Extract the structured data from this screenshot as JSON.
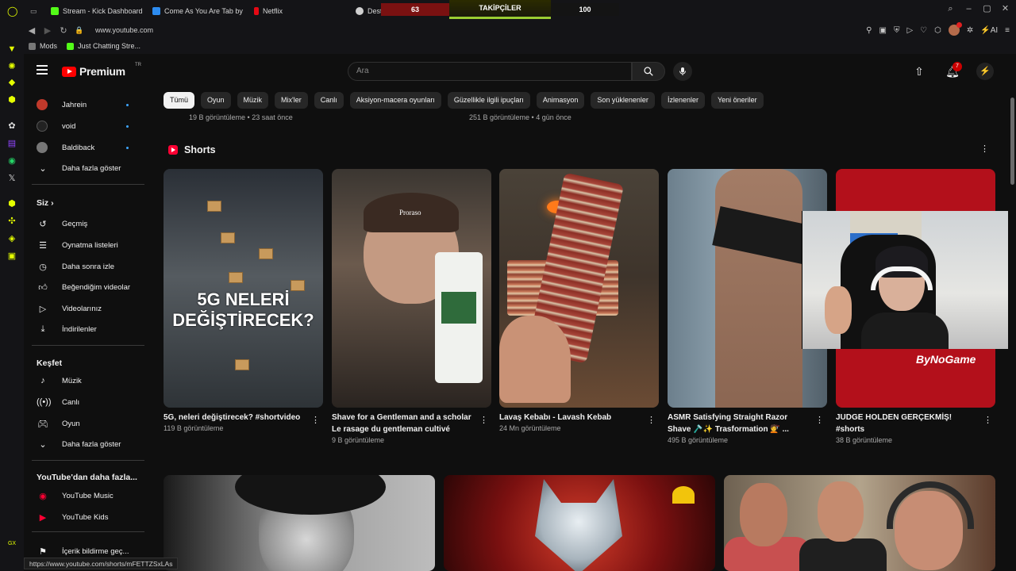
{
  "browser": {
    "tabs": [
      {
        "label": "Stream - Kick Dashboard",
        "color": "#53fc18"
      },
      {
        "label": "Come As You Are Tab by",
        "color": "#2d8cf0"
      },
      {
        "label": "Netflix",
        "color": "#e50914"
      },
      {
        "label": "Deste",
        "color": "#d0d0d0"
      }
    ],
    "url": "www.youtube.com",
    "bookmarks": [
      {
        "label": "Mods",
        "color": "#777777"
      },
      {
        "label": "Just Chatting Stre...",
        "color": "#53fc18"
      }
    ],
    "status_url": "https://www.youtube.com/shorts/mFETTZSxLAs"
  },
  "overlay": {
    "left_value": "63",
    "center_label": "TAKİPÇİLER",
    "right_value": "100"
  },
  "youtube": {
    "logo_text": "Premium",
    "logo_country": "TR",
    "search_placeholder": "Ara",
    "notification_count": "7",
    "sidebar": {
      "channels": [
        {
          "label": "Jahrein",
          "color": "#c0392b"
        },
        {
          "label": "void",
          "color": "#222222"
        },
        {
          "label": "Baldiback",
          "color": "#777777"
        }
      ],
      "show_more_1": "Daha fazla göster",
      "you_title": "Siz",
      "you_items": [
        {
          "label": "Geçmiş",
          "icon": "history-icon"
        },
        {
          "label": "Oynatma listeleri",
          "icon": "playlist-icon"
        },
        {
          "label": "Daha sonra izle",
          "icon": "watch-later-icon"
        },
        {
          "label": "Beğendiğim videolar",
          "icon": "like-icon"
        },
        {
          "label": "Videolarınız",
          "icon": "your-videos-icon"
        },
        {
          "label": "İndirilenler",
          "icon": "download-icon"
        }
      ],
      "explore_title": "Keşfet",
      "explore_items": [
        {
          "label": "Müzik",
          "icon": "music-icon"
        },
        {
          "label": "Canlı",
          "icon": "live-icon"
        },
        {
          "label": "Oyun",
          "icon": "gaming-icon"
        }
      ],
      "show_more_2": "Daha fazla göster",
      "more_title": "YouTube'dan daha fazla...",
      "more_items": [
        {
          "label": "YouTube Music",
          "icon": "youtube-music-icon"
        },
        {
          "label": "YouTube Kids",
          "icon": "youtube-kids-icon"
        }
      ],
      "report_label": "İçerik bildirme geç..."
    },
    "chips": [
      "Tümü",
      "Oyun",
      "Müzik",
      "Mix'ler",
      "Canlı",
      "Aksiyon-macera oyunları",
      "Güzellikle ilgili ipuçları",
      "Animasyon",
      "Son yüklenenler",
      "İzlenenler",
      "Yeni öneriler"
    ],
    "prev_meta": [
      "19 B görüntüleme • 23 saat önce",
      "251 B görüntüleme • 4 gün önce"
    ],
    "shorts_title": "Shorts",
    "shorts": [
      {
        "title": "5G, neleri değiştirecek? #shortvideo",
        "views": "119 B görüntüleme",
        "overlay": "5G NELERİ\nDEĞİŞTİRECEK?"
      },
      {
        "title": "Shave for a Gentleman and a scholar Le rasage du gentleman cultivé",
        "views": "9 B görüntüleme",
        "overlay": "Proraso"
      },
      {
        "title": "Lavaş Kebabı - Lavash Kebab",
        "views": "24 Mn görüntüleme"
      },
      {
        "title": "ASMR Satisfying Straight Razor Shave 🪒✨ Trasformation 💇 ...",
        "views": "495 B görüntüleme"
      },
      {
        "title": "JUDGE HOLDEN GERÇEKMİŞ! #shorts",
        "views": "38 B görüntüleme"
      }
    ],
    "sponsor": "ByNoGame"
  }
}
